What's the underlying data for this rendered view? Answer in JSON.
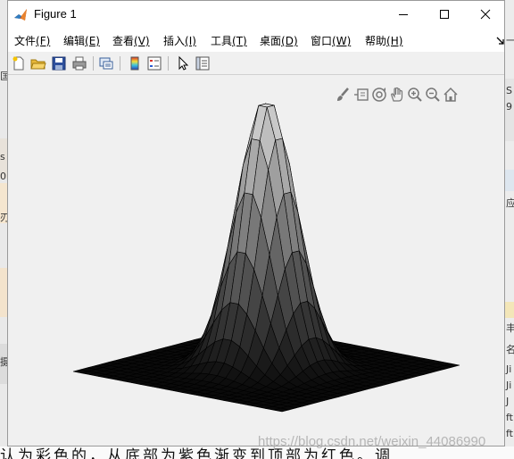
{
  "window": {
    "title": "Figure 1"
  },
  "menu": [
    {
      "label": "文件",
      "key": "(F)"
    },
    {
      "label": "编辑",
      "key": "(E)"
    },
    {
      "label": "查看",
      "key": "(V)"
    },
    {
      "label": "插入",
      "key": "(I)"
    },
    {
      "label": "工具",
      "key": "(T)"
    },
    {
      "label": "桌面",
      "key": "(D)"
    },
    {
      "label": "窗口",
      "key": "(W)"
    },
    {
      "label": "帮助",
      "key": "(H)"
    }
  ],
  "toolbar_icons": [
    "new-figure-icon",
    "open-file-icon",
    "save-icon",
    "print-icon",
    "link-figure-icon",
    "insert-colorbar-icon",
    "insert-legend-icon",
    "edit-plot-icon",
    "property-inspector-icon"
  ],
  "axes_toolbar_icons": [
    "brush-icon",
    "data-tips-icon",
    "rotate-3d-icon",
    "pan-icon",
    "zoom-in-icon",
    "zoom-out-icon",
    "home-icon"
  ],
  "chart_data": {
    "type": "surface",
    "title": "",
    "xlabel": "",
    "ylabel": "",
    "zlabel": "",
    "axes_visible": false,
    "grid": false,
    "colormap": "gray",
    "function": "gaussian bump z = exp(-(x^2 + y^2)/s^2) on a flat square base",
    "xlim": [
      -3,
      3
    ],
    "ylim": [
      -3,
      3
    ],
    "zlim": [
      0,
      1
    ],
    "peak": {
      "x": 0,
      "y": 0,
      "z": 1
    },
    "mesh_lines": 25
  },
  "background": {
    "bottom_text": "认为彩色的，从底部为紫色渐变到顶部为红色。调",
    "left_fragments": [
      "匡",
      "s",
      "0",
      "刃",
      "摄"
    ],
    "right_fragments": [
      "一",
      "S",
      "9",
      "应",
      "丰",
      "名",
      "Ji",
      "Ji",
      "J",
      "ft",
      "ft"
    ]
  },
  "watermark": "https://blog.csdn.net/weixin_44086990"
}
